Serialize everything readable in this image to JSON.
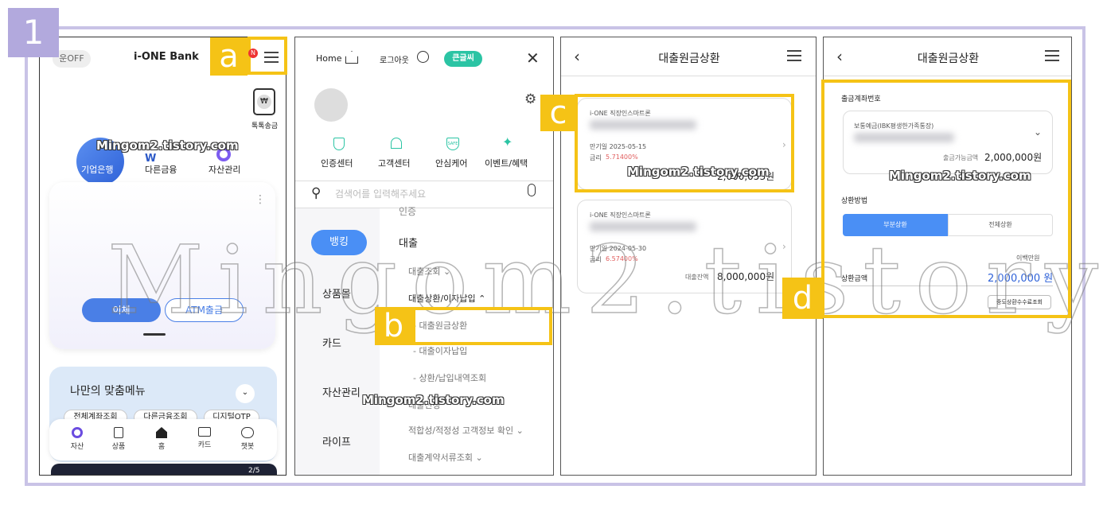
{
  "step_number": "1",
  "watermarks": {
    "small": "Mingom2.tistory.com",
    "big": "Mingom2.tistory.com"
  },
  "callouts": {
    "a": "a",
    "b": "b",
    "c": "c",
    "d": "d"
  },
  "screen1": {
    "mode_toggle": "운OFF",
    "logo": "i-ONE Bank",
    "notification_badge": "N",
    "quick_icon_label": "톡톡송금",
    "nav": [
      "기업은행",
      "다른금융",
      "자산관리"
    ],
    "more_dots": "⋮",
    "transfer_button": "이체",
    "atm_button": "ATM출금",
    "my_menu_title": "나만의 맞춤메뉴",
    "chips": [
      "전체계좌조회",
      "다른금융조회",
      "디지털OTP"
    ],
    "tabbar": [
      "자산",
      "상품",
      "홈",
      "카드",
      "챗봇"
    ],
    "banner_page": "2/5",
    "currency_glyph": "₩"
  },
  "screen2": {
    "home": "Home",
    "logout": "로그아웃",
    "font_toggle": "큰글씨",
    "quick_menus": [
      "인증센터",
      "고객센터",
      "안심케어",
      "이벤트/혜택"
    ],
    "safe_badge": "SAFE",
    "search_placeholder": "검색어를 입력해주세요",
    "categories": [
      "뱅킹",
      "상품몰",
      "카드",
      "자산관리",
      "라이프"
    ],
    "partial_top": "인증",
    "section_title": "대출",
    "items": [
      {
        "label": "대출조회 ⌄"
      },
      {
        "label": "대출상환/이자납입 ⌃"
      },
      {
        "label": "- 대출원금상환"
      },
      {
        "label": "- 대출이자납입"
      },
      {
        "label": "- 상환/납입내역조회"
      },
      {
        "label": "대출신청"
      },
      {
        "label": "적합성/적정성 고객정보 확인 ⌄"
      },
      {
        "label": "대출계약서류조회 ⌄"
      }
    ]
  },
  "screen3": {
    "title": "대출원금상환",
    "cards": [
      {
        "product": "i-ONE 직장인스마트론",
        "maturity": "만기일 2025-05-15",
        "rate_label": "금리",
        "rate": "5.71400%",
        "balance": "2,000,053원",
        "balance_label": ""
      },
      {
        "product": "i-ONE 직장인스마트론",
        "maturity": "만기일 2024-05-30",
        "rate_label": "금리",
        "rate": "6.57400%",
        "balance": "8,000,000원",
        "balance_label": "대출잔액"
      }
    ]
  },
  "screen4": {
    "title": "대출원금상환",
    "account_section": "출금계좌번호",
    "account_name": "보통예금(IBK평생한가족통장)",
    "available_label": "출금가능금액",
    "available_amount": "2,000,000원",
    "method_label": "상환방법",
    "method_options": [
      "부분상환",
      "전체상환"
    ],
    "unit_hint": "이백만원",
    "amount_label": "상환금액",
    "amount_value": "2,000,000 원",
    "fee_button": "중도상환수수료조회"
  },
  "colors": {
    "accent_yellow": "#f5c316",
    "frame": "#c9c3e6",
    "blue": "#4a8ff5",
    "teal": "#2bc4a4",
    "red_rate": "#e05c5c"
  }
}
